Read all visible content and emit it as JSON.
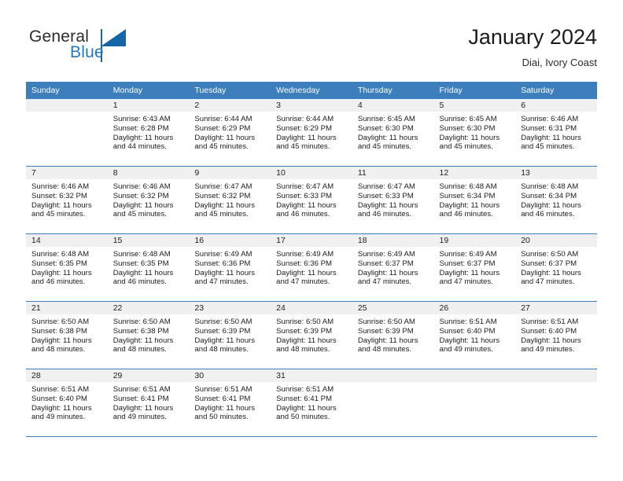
{
  "brand": {
    "word_one": "General",
    "word_two": "Blue",
    "triangle_icon": "brand-triangle-icon",
    "accent_color": "#1f78c1",
    "dark_text_color": "#2b2b2b"
  },
  "header": {
    "title": "January 2024",
    "subtitle": "Diai, Ivory Coast"
  },
  "calendar": {
    "header_bg": "#3d7ebd",
    "daynum_bg": "#f0f0f0",
    "weekday_headers": [
      "Sunday",
      "Monday",
      "Tuesday",
      "Wednesday",
      "Thursday",
      "Friday",
      "Saturday"
    ],
    "labels": {
      "sunrise": "Sunrise:",
      "sunset": "Sunset:",
      "daylight": "Daylight:"
    },
    "weeks": [
      [
        {
          "day": "",
          "lines": []
        },
        {
          "day": "1",
          "lines": [
            "Sunrise: 6:43 AM",
            "Sunset: 6:28 PM",
            "Daylight: 11 hours",
            "and 44 minutes."
          ]
        },
        {
          "day": "2",
          "lines": [
            "Sunrise: 6:44 AM",
            "Sunset: 6:29 PM",
            "Daylight: 11 hours",
            "and 45 minutes."
          ]
        },
        {
          "day": "3",
          "lines": [
            "Sunrise: 6:44 AM",
            "Sunset: 6:29 PM",
            "Daylight: 11 hours",
            "and 45 minutes."
          ]
        },
        {
          "day": "4",
          "lines": [
            "Sunrise: 6:45 AM",
            "Sunset: 6:30 PM",
            "Daylight: 11 hours",
            "and 45 minutes."
          ]
        },
        {
          "day": "5",
          "lines": [
            "Sunrise: 6:45 AM",
            "Sunset: 6:30 PM",
            "Daylight: 11 hours",
            "and 45 minutes."
          ]
        },
        {
          "day": "6",
          "lines": [
            "Sunrise: 6:46 AM",
            "Sunset: 6:31 PM",
            "Daylight: 11 hours",
            "and 45 minutes."
          ]
        }
      ],
      [
        {
          "day": "7",
          "lines": [
            "Sunrise: 6:46 AM",
            "Sunset: 6:32 PM",
            "Daylight: 11 hours",
            "and 45 minutes."
          ]
        },
        {
          "day": "8",
          "lines": [
            "Sunrise: 6:46 AM",
            "Sunset: 6:32 PM",
            "Daylight: 11 hours",
            "and 45 minutes."
          ]
        },
        {
          "day": "9",
          "lines": [
            "Sunrise: 6:47 AM",
            "Sunset: 6:32 PM",
            "Daylight: 11 hours",
            "and 45 minutes."
          ]
        },
        {
          "day": "10",
          "lines": [
            "Sunrise: 6:47 AM",
            "Sunset: 6:33 PM",
            "Daylight: 11 hours",
            "and 46 minutes."
          ]
        },
        {
          "day": "11",
          "lines": [
            "Sunrise: 6:47 AM",
            "Sunset: 6:33 PM",
            "Daylight: 11 hours",
            "and 46 minutes."
          ]
        },
        {
          "day": "12",
          "lines": [
            "Sunrise: 6:48 AM",
            "Sunset: 6:34 PM",
            "Daylight: 11 hours",
            "and 46 minutes."
          ]
        },
        {
          "day": "13",
          "lines": [
            "Sunrise: 6:48 AM",
            "Sunset: 6:34 PM",
            "Daylight: 11 hours",
            "and 46 minutes."
          ]
        }
      ],
      [
        {
          "day": "14",
          "lines": [
            "Sunrise: 6:48 AM",
            "Sunset: 6:35 PM",
            "Daylight: 11 hours",
            "and 46 minutes."
          ]
        },
        {
          "day": "15",
          "lines": [
            "Sunrise: 6:48 AM",
            "Sunset: 6:35 PM",
            "Daylight: 11 hours",
            "and 46 minutes."
          ]
        },
        {
          "day": "16",
          "lines": [
            "Sunrise: 6:49 AM",
            "Sunset: 6:36 PM",
            "Daylight: 11 hours",
            "and 47 minutes."
          ]
        },
        {
          "day": "17",
          "lines": [
            "Sunrise: 6:49 AM",
            "Sunset: 6:36 PM",
            "Daylight: 11 hours",
            "and 47 minutes."
          ]
        },
        {
          "day": "18",
          "lines": [
            "Sunrise: 6:49 AM",
            "Sunset: 6:37 PM",
            "Daylight: 11 hours",
            "and 47 minutes."
          ]
        },
        {
          "day": "19",
          "lines": [
            "Sunrise: 6:49 AM",
            "Sunset: 6:37 PM",
            "Daylight: 11 hours",
            "and 47 minutes."
          ]
        },
        {
          "day": "20",
          "lines": [
            "Sunrise: 6:50 AM",
            "Sunset: 6:37 PM",
            "Daylight: 11 hours",
            "and 47 minutes."
          ]
        }
      ],
      [
        {
          "day": "21",
          "lines": [
            "Sunrise: 6:50 AM",
            "Sunset: 6:38 PM",
            "Daylight: 11 hours",
            "and 48 minutes."
          ]
        },
        {
          "day": "22",
          "lines": [
            "Sunrise: 6:50 AM",
            "Sunset: 6:38 PM",
            "Daylight: 11 hours",
            "and 48 minutes."
          ]
        },
        {
          "day": "23",
          "lines": [
            "Sunrise: 6:50 AM",
            "Sunset: 6:39 PM",
            "Daylight: 11 hours",
            "and 48 minutes."
          ]
        },
        {
          "day": "24",
          "lines": [
            "Sunrise: 6:50 AM",
            "Sunset: 6:39 PM",
            "Daylight: 11 hours",
            "and 48 minutes."
          ]
        },
        {
          "day": "25",
          "lines": [
            "Sunrise: 6:50 AM",
            "Sunset: 6:39 PM",
            "Daylight: 11 hours",
            "and 48 minutes."
          ]
        },
        {
          "day": "26",
          "lines": [
            "Sunrise: 6:51 AM",
            "Sunset: 6:40 PM",
            "Daylight: 11 hours",
            "and 49 minutes."
          ]
        },
        {
          "day": "27",
          "lines": [
            "Sunrise: 6:51 AM",
            "Sunset: 6:40 PM",
            "Daylight: 11 hours",
            "and 49 minutes."
          ]
        }
      ],
      [
        {
          "day": "28",
          "lines": [
            "Sunrise: 6:51 AM",
            "Sunset: 6:40 PM",
            "Daylight: 11 hours",
            "and 49 minutes."
          ]
        },
        {
          "day": "29",
          "lines": [
            "Sunrise: 6:51 AM",
            "Sunset: 6:41 PM",
            "Daylight: 11 hours",
            "and 49 minutes."
          ]
        },
        {
          "day": "30",
          "lines": [
            "Sunrise: 6:51 AM",
            "Sunset: 6:41 PM",
            "Daylight: 11 hours",
            "and 50 minutes."
          ]
        },
        {
          "day": "31",
          "lines": [
            "Sunrise: 6:51 AM",
            "Sunset: 6:41 PM",
            "Daylight: 11 hours",
            "and 50 minutes."
          ]
        },
        {
          "day": "",
          "lines": []
        },
        {
          "day": "",
          "lines": []
        },
        {
          "day": "",
          "lines": []
        }
      ]
    ]
  }
}
